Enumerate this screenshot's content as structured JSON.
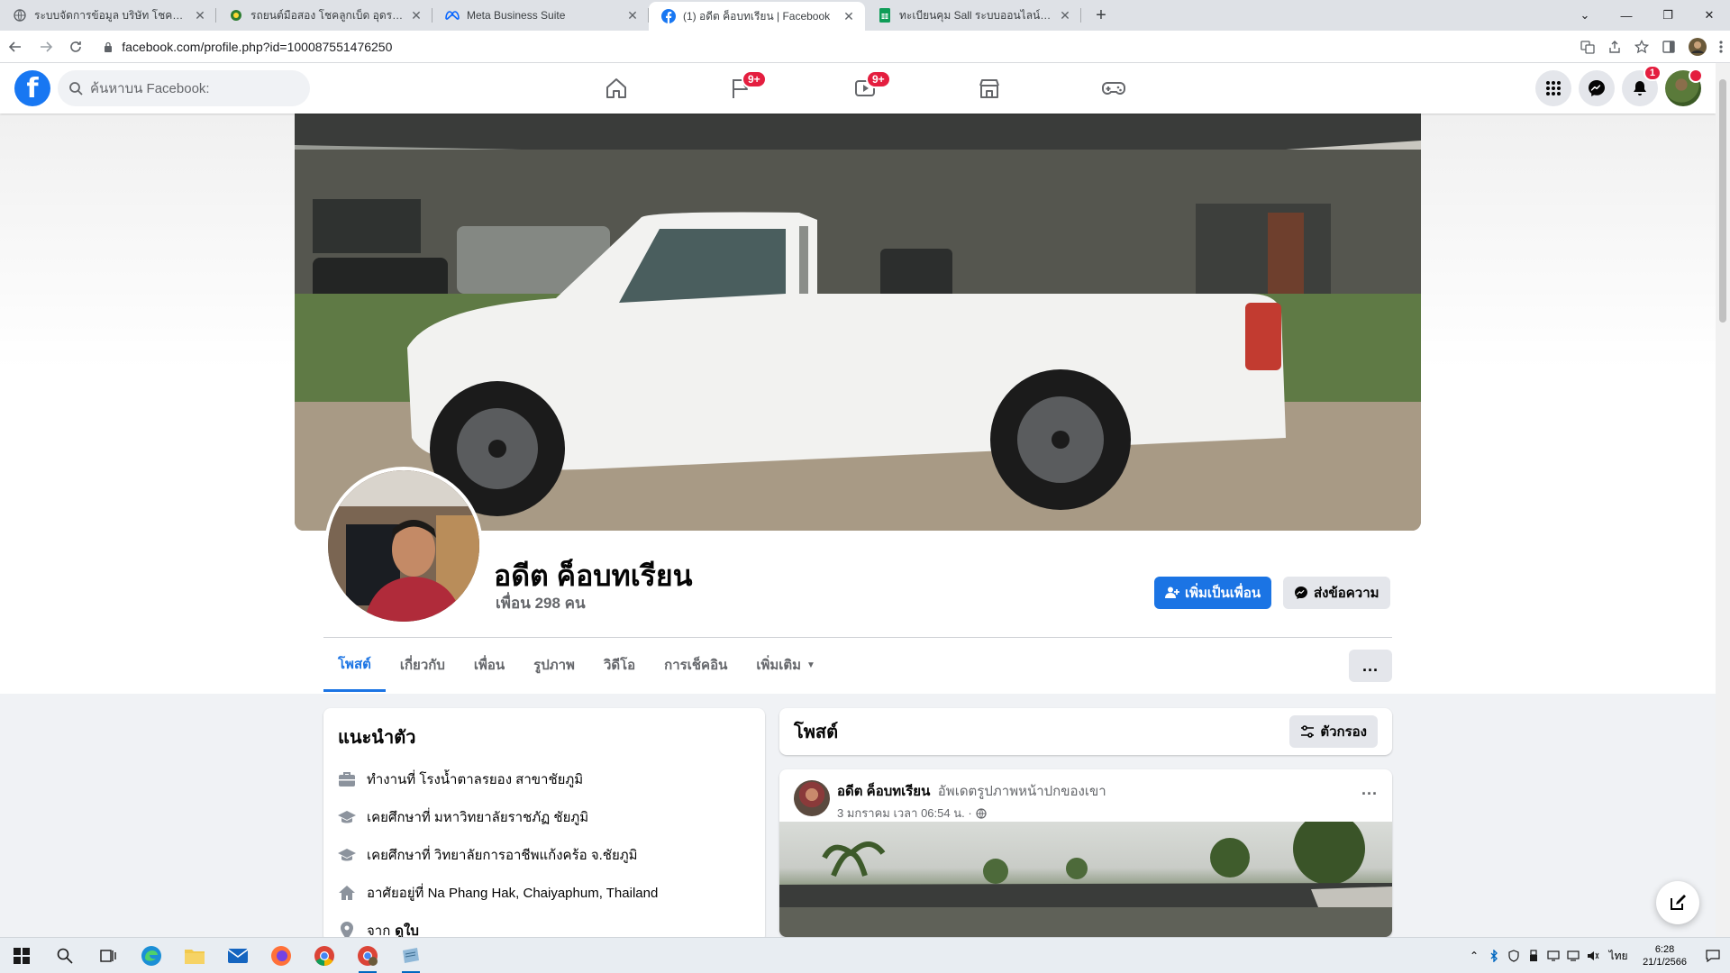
{
  "browser": {
    "tabs": [
      {
        "title": "ระบบจัดการข้อมูล บริษัท โชคลูกเบ็ด"
      },
      {
        "title": "รถยนต์มือสอง โชคลูกเบ็ด อุดรธานี"
      },
      {
        "title": "Meta Business Suite"
      },
      {
        "title": "(1) อดีต ค็อบทเรียน | Facebook"
      },
      {
        "title": "ทะเบียนคุม Sall ระบบออนไลน์.xlsx - G"
      }
    ],
    "url": "facebook.com/profile.php?id=100087551476250"
  },
  "fb": {
    "logo": "f",
    "search_placeholder": "ค้นหาบน Facebook:",
    "badges": {
      "pages": "9+",
      "watch": "9+",
      "notifications": "1"
    }
  },
  "profile": {
    "name": "อดีต ค็อบทเรียน",
    "friends": "เพื่อน 298 คน",
    "add_friend": "เพิ่มเป็นเพื่อน",
    "message": "ส่งข้อความ",
    "tabs": [
      "โพสต์",
      "เกี่ยวกับ",
      "เพื่อน",
      "รูปภาพ",
      "วิดีโอ",
      "การเช็คอิน",
      "เพิ่มเติม"
    ],
    "more_button": "..."
  },
  "intro": {
    "title": "แนะนำตัว",
    "items": [
      {
        "icon": "briefcase-icon",
        "text": "ทำงานที่ โรงน้ำตาลรยอง สาขาชัยภูมิ"
      },
      {
        "icon": "graduation-cap-icon",
        "text": "เคยศึกษาที่ มหาวิทยาลัยราชภัฏ ชัยภูมิ"
      },
      {
        "icon": "graduation-cap-icon",
        "text": "เคยศึกษาที่ วิทยาลัยการอาชีพแก้งคร้อ จ.ชัยภูมิ"
      },
      {
        "icon": "home-icon",
        "text": "อาศัยอยู่ที่ Na Phang Hak, Chaiyaphum, Thailand"
      },
      {
        "icon": "location-pin-icon",
        "text": "จาก",
        "bold": "ดูใบ"
      }
    ]
  },
  "posts": {
    "title": "โพสต์",
    "filter": "ตัวกรอง",
    "first": {
      "author": "อดีต ค็อบทเรียน",
      "action": "อัพเดตรูปภาพหน้าปกของเขา",
      "time": "3 มกราคม เวลา 06:54 น. ·",
      "menu": "..."
    }
  },
  "taskbar": {
    "lang": "ไทย",
    "time": "6:28",
    "date": "21/1/2566"
  },
  "colors": {
    "fb_blue": "#1877f2",
    "badge_red": "#e41e3f",
    "tab_active_blue": "#1b74e4"
  }
}
